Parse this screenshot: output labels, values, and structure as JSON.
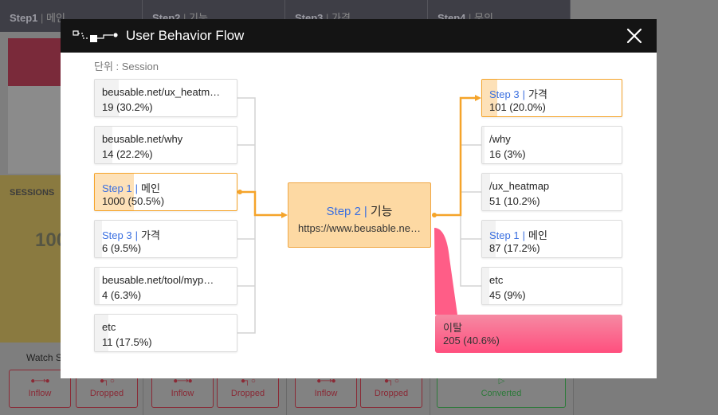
{
  "background": {
    "tabs": [
      {
        "step": "Step1",
        "name": "메인"
      },
      {
        "step": "Step2",
        "name": "기능"
      },
      {
        "step": "Step3",
        "name": "가격"
      },
      {
        "step": "Step4",
        "name": "문의"
      }
    ],
    "sessions_label": "SESSIONS",
    "sessions_value": "100",
    "watch_label": "Watch S",
    "buttons": {
      "inflow": "Inflow",
      "dropped": "Dropped",
      "converted": "Converted"
    }
  },
  "modal": {
    "title": "User Behavior Flow",
    "unit_label": "단위 : Session",
    "left_nodes": [
      {
        "l1": "beusable.net/ux_heatm…",
        "l2": "19 (30.2%)",
        "share": 0.302
      },
      {
        "l1": "beusable.net/why",
        "l2": "14 (22.2%)",
        "share": 0.222
      },
      {
        "step": "Step 1",
        "name": "메인",
        "l2": "1000 (50.5%)",
        "share": 0.505
      },
      {
        "step": "Step 3",
        "name": "가격",
        "l2": "6 (9.5%)",
        "share": 0.095
      },
      {
        "l1": "beusable.net/tool/myp…",
        "l2": "4 (6.3%)",
        "share": 0.063
      },
      {
        "l1": "etc",
        "l2": "11 (17.5%)",
        "share": 0.175
      }
    ],
    "center": {
      "step": "Step 2",
      "name": "기능",
      "url": "https://www.beusable.ne…"
    },
    "right_nodes": [
      {
        "step": "Step 3",
        "name": "가격",
        "l2": "101 (20.0%)",
        "share": 0.2
      },
      {
        "l1": "/why",
        "l2": "16 (3%)",
        "share": 0.03
      },
      {
        "l1": "/ux_heatmap",
        "l2": "51 (10.2%)",
        "share": 0.102
      },
      {
        "step": "Step 1",
        "name": "메인",
        "l2": "87 (17.2%)",
        "share": 0.172
      },
      {
        "l1": "etc",
        "l2": "45 (9%)",
        "share": 0.09
      }
    ],
    "exit": {
      "label": "이탈",
      "value": "205 (40.6%)",
      "share": 0.406
    }
  },
  "colors": {
    "accent": "#f5a42a",
    "step_blue": "#3a6fe0",
    "exit_pink": "#ff4f7e",
    "header": "#141414"
  }
}
